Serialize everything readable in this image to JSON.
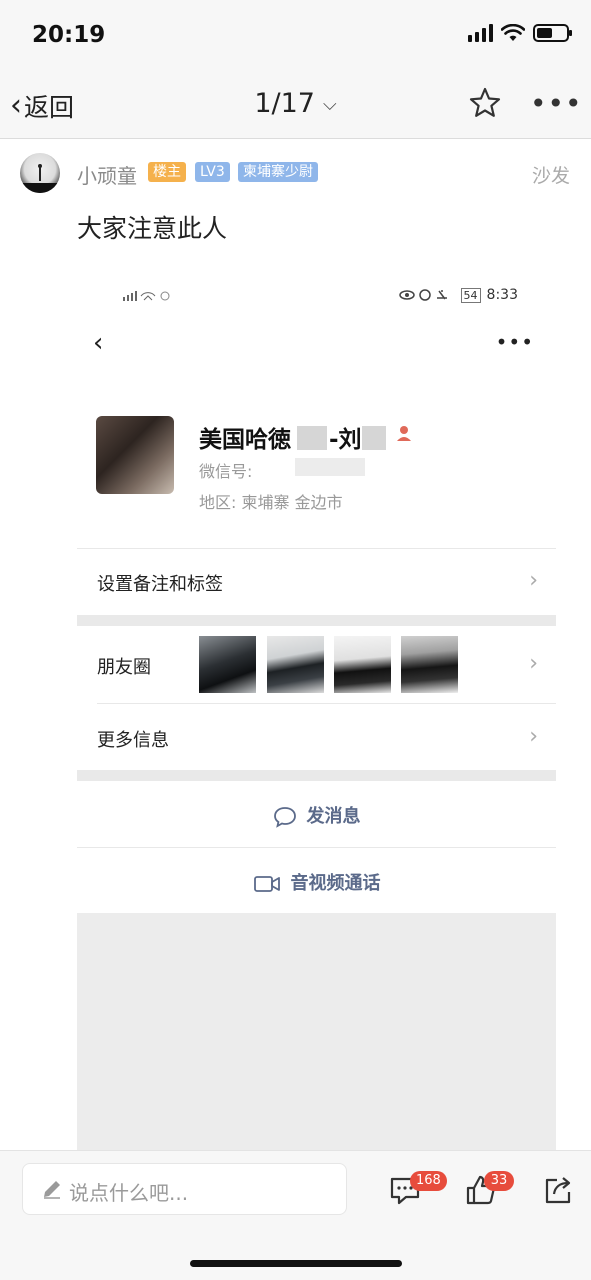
{
  "status_bar": {
    "time": "20:19"
  },
  "nav": {
    "back_label": "返回",
    "page_indicator": "1/17"
  },
  "post": {
    "username": "小顽童",
    "badges": [
      {
        "label": "楼主",
        "color": "#f5b14c"
      },
      {
        "label": "LV3",
        "color": "#8fb6ea"
      },
      {
        "label": "柬埔寨少尉",
        "color": "#8fb6ea"
      }
    ],
    "floor": "沙发",
    "text": "大家注意此人"
  },
  "embedded": {
    "status_time": "8:33",
    "battery": "54",
    "profile": {
      "name_part1": "美国哈徳",
      "name_part2": "-刘",
      "wechat_label": "微信号: ",
      "region": "地区:  柬埔寨  金边市"
    },
    "rows": {
      "set_remark": "设置备注和标签",
      "moments": "朋友圈",
      "more_info": "更多信息"
    },
    "actions": {
      "send_message": "发消息",
      "video_call": "音视频通话"
    }
  },
  "bottom": {
    "placeholder": "说点什么吧...",
    "comment_count": "168",
    "like_count": "33"
  }
}
